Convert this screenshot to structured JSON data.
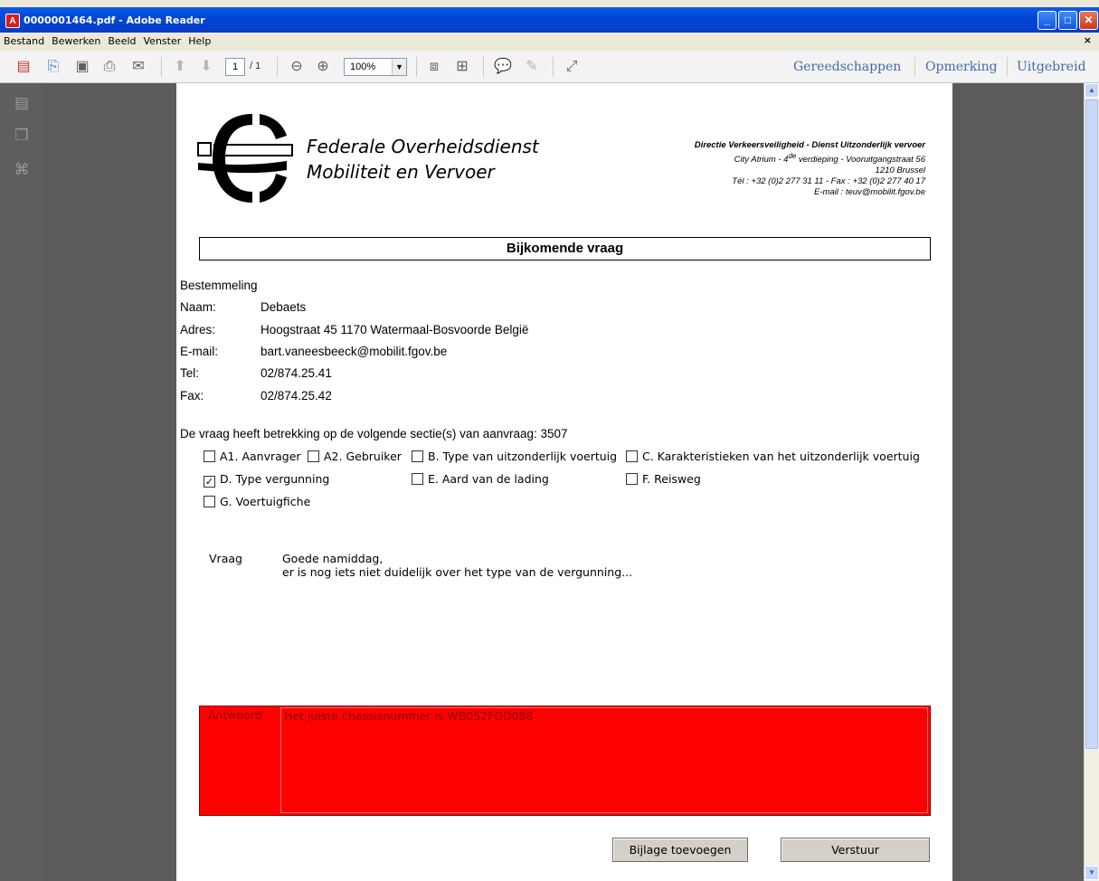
{
  "window": {
    "title": "0000001464.pdf - Adobe Reader",
    "btn_min": "_",
    "btn_max": "□",
    "btn_close": "✕"
  },
  "menu": [
    "Bestand",
    "Bewerken",
    "Beeld",
    "Venster",
    "Help"
  ],
  "menu_close": "×",
  "toolbar": {
    "page_current": "1",
    "page_total": "/ 1",
    "zoom": "100%",
    "tools": "Gereedschappen",
    "comment": "Opmerking",
    "extended": "Uitgebreid"
  },
  "document": {
    "org_line1": "Federale Overheidsdienst",
    "org_line2": "Mobiliteit en Vervoer",
    "addr_line1": "Directie Verkeersveiligheid - Dienst Uitzonderlijk vervoer",
    "addr_line2a": "City Atrium  - 4",
    "addr_line2sup": "de",
    "addr_line2b": " verdieping - Vooruitgangstraat 56",
    "addr_line3": "1210 Brussel",
    "addr_line4": "Tél : +32 (0)2 277 31 11 - Fax : +32 (0)2 277 40 17",
    "addr_line5": "E-mail : teuv@mobilit.fgov.be",
    "heading": "Bijkomende vraag",
    "recipient_label": "Bestemmeling",
    "fields": [
      {
        "label": "Naam:",
        "value": "Debaets"
      },
      {
        "label": "Adres:",
        "value": "Hoogstraat 45   1170   Watermaal-Bosvoorde   België"
      },
      {
        "label": "E-mail:",
        "value": "bart.vaneesbeeck@mobilit.fgov.be"
      },
      {
        "label": "Tel:",
        "value": "02/874.25.41"
      },
      {
        "label": "Fax:",
        "value": "02/874.25.42"
      }
    ],
    "sections_text": "De vraag heeft betrekking op de volgende sectie(s) van aanvraag:  3507",
    "checkboxes": [
      {
        "label": "A1. Aanvrager",
        "checked": false
      },
      {
        "label": "A2. Gebruiker",
        "checked": false
      },
      {
        "label": "B. Type van uitzonderlijk voertuig",
        "checked": false
      },
      {
        "label": "C. Karakteristieken van het uitzonderlijk voertuig",
        "checked": false
      },
      {
        "label": "D. Type vergunning",
        "checked": true
      },
      {
        "label": "E. Aard van de lading",
        "checked": false
      },
      {
        "label": "F. Reisweg",
        "checked": false
      },
      {
        "label": "G. Voertuigfiche",
        "checked": false
      }
    ],
    "check_mark": "✓",
    "question_label": "Vraag",
    "question_line1": "Goede namiddag,",
    "question_line2": "er is nog iets niet duidelijk over het type van de vergunning...",
    "answer_label": "Antwoord",
    "answer_text": "Het juiste chassisnummer is WB052FGD088",
    "btn_attach": "Bijlage toevoegen",
    "btn_send": "Verstuur"
  },
  "colors": {
    "answer_bg": "#ff0000",
    "title_bar": "#0047d6",
    "link_text": "#3f6ba9"
  }
}
